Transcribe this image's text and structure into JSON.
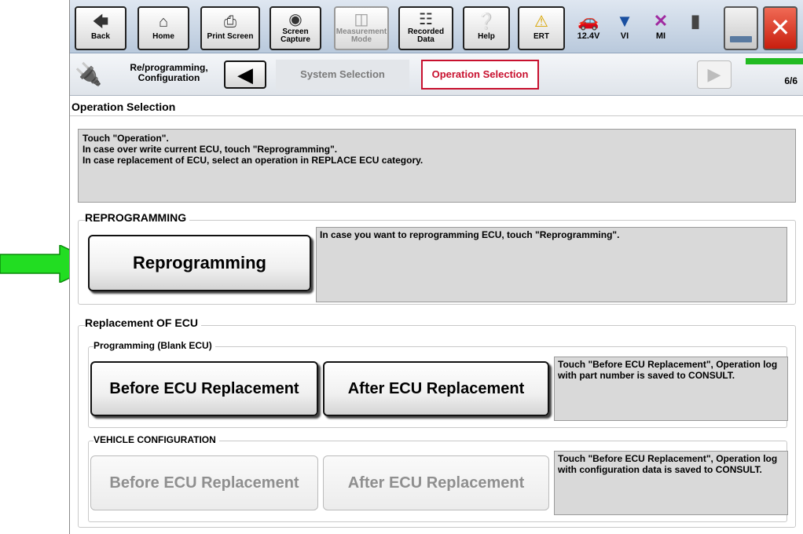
{
  "toolbar": {
    "buttons": [
      {
        "label": "Back",
        "icon": "left-arrow-icon"
      },
      {
        "label": "Home",
        "icon": "home-icon"
      },
      {
        "label": "Print Screen",
        "icon": "printer-icon"
      },
      {
        "label": "Screen Capture",
        "icon": "camera-icon"
      },
      {
        "label": "Measurement Mode",
        "icon": "measurement-icon"
      },
      {
        "label": "Recorded Data",
        "icon": "recorded-data-icon"
      },
      {
        "label": "Help",
        "icon": "help-icon"
      },
      {
        "label": "ERT",
        "icon": "warning-icon"
      }
    ],
    "status": [
      {
        "label": "12.4V",
        "icon": "car-battery-icon"
      },
      {
        "label": "VI",
        "icon": "vi-signal-icon"
      },
      {
        "label": "MI",
        "icon": "mi-x-icon"
      }
    ]
  },
  "breadcrumb": {
    "app_label": "Re/programming, Configuration",
    "steps": [
      "System Selection",
      "Operation Selection"
    ],
    "progress": "6/6"
  },
  "page_title": "Operation Selection",
  "instructions": [
    "Touch \"Operation\".",
    "In case over write current ECU, touch \"Reprogramming\".",
    "In case replacement of ECU, select an operation in REPLACE ECU category."
  ],
  "reprogramming": {
    "title": "REPROGRAMMING",
    "button": "Reprogramming",
    "description": "In case you want to reprogramming ECU, touch \"Reprogramming\"."
  },
  "replacement": {
    "title": "Replacement OF ECU",
    "programming": {
      "title": "Programming (Blank ECU)",
      "before": "Before ECU Replacement",
      "after": "After ECU Replacement",
      "description": "Touch \"Before ECU Replacement\", Operation log with part number is saved to CONSULT."
    },
    "vehicle_config": {
      "title": "VEHICLE CONFIGURATION",
      "before": "Before ECU Replacement",
      "after": "After ECU Replacement",
      "description": "Touch \"Before ECU Replacement\", Operation log with configuration data is saved to CONSULT."
    }
  },
  "colors": {
    "accent": "#c8102e",
    "arrow": "#22dd22",
    "panel": "#d9d9d9"
  }
}
